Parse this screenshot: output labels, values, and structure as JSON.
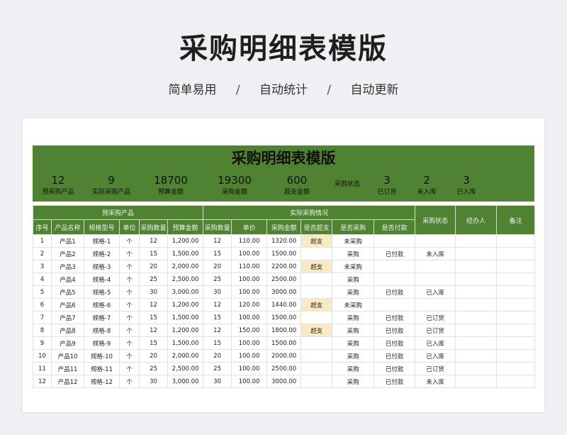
{
  "header": {
    "title": "采购明细表模版",
    "tags": [
      "简单易用",
      "自动统计",
      "自动更新"
    ],
    "sep": "/"
  },
  "sheet": {
    "title": "采购明细表模版",
    "summary": [
      {
        "value": "12",
        "label": "预采购产品"
      },
      {
        "value": "9",
        "label": "实际采购产品"
      },
      {
        "value": "18700",
        "label": "预算金额"
      },
      {
        "value": "19300",
        "label": "采购金额"
      },
      {
        "value": "600",
        "label": "超支金额"
      },
      {
        "value": "",
        "label": "采购状态"
      },
      {
        "value": "3",
        "label": "已订货"
      },
      {
        "value": "2",
        "label": "未入库"
      },
      {
        "value": "3",
        "label": "已入库"
      }
    ],
    "group_headers": {
      "planned": "预采购产品",
      "actual": "实际采购情况",
      "status": "采购状态",
      "handler": "经办人",
      "remark": "备注"
    },
    "columns": [
      "序号",
      "产品名称",
      "规格型号",
      "单位",
      "采购数量",
      "预算金额",
      "采购数量",
      "单价",
      "采购金额",
      "是否超支",
      "是否采购",
      "是否付款"
    ],
    "rows": [
      [
        "1",
        "产品1",
        "规格-1",
        "个",
        "12",
        "1,200.00",
        "12",
        "110.00",
        "1320.00",
        "超支",
        "未采购",
        "",
        ""
      ],
      [
        "2",
        "产品2",
        "规格-2",
        "个",
        "15",
        "1,500.00",
        "15",
        "100.00",
        "1500.00",
        "",
        "采购",
        "已付款",
        "未入库"
      ],
      [
        "3",
        "产品3",
        "规格-3",
        "个",
        "20",
        "2,000.00",
        "20",
        "110.00",
        "2200.00",
        "超支",
        "未采购",
        "",
        ""
      ],
      [
        "4",
        "产品4",
        "规格-4",
        "个",
        "25",
        "2,500.00",
        "25",
        "100.00",
        "2500.00",
        "",
        "采购",
        "",
        ""
      ],
      [
        "5",
        "产品5",
        "规格-5",
        "个",
        "30",
        "3,000.00",
        "30",
        "100.00",
        "3000.00",
        "",
        "采购",
        "已付款",
        "已入库"
      ],
      [
        "6",
        "产品6",
        "规格-6",
        "个",
        "12",
        "1,200.00",
        "12",
        "120.00",
        "1440.00",
        "超支",
        "未采购",
        "",
        ""
      ],
      [
        "7",
        "产品7",
        "规格-7",
        "个",
        "15",
        "1,500.00",
        "15",
        "100.00",
        "1500.00",
        "",
        "采购",
        "已付款",
        "已订货"
      ],
      [
        "8",
        "产品8",
        "规格-8",
        "个",
        "12",
        "1,200.00",
        "12",
        "150.00",
        "1800.00",
        "超支",
        "采购",
        "已付款",
        "已订货"
      ],
      [
        "9",
        "产品9",
        "规格-9",
        "个",
        "15",
        "1,500.00",
        "15",
        "100.00",
        "1500.00",
        "",
        "采购",
        "已付款",
        "已入库"
      ],
      [
        "10",
        "产品10",
        "规格-10",
        "个",
        "20",
        "2,000.00",
        "20",
        "100.00",
        "2000.00",
        "",
        "采购",
        "已付款",
        "已入库"
      ],
      [
        "11",
        "产品11",
        "规格-11",
        "个",
        "25",
        "2,500.00",
        "25",
        "100.00",
        "2500.00",
        "",
        "采购",
        "已付款",
        "已订货"
      ],
      [
        "12",
        "产品12",
        "规格-12",
        "个",
        "30",
        "3,000.00",
        "30",
        "100.00",
        "3000.00",
        "",
        "采购",
        "已付款",
        "未入库"
      ]
    ],
    "colors": {
      "header_green": "#4f8331",
      "warn_fill": "#fbe9c4"
    }
  }
}
